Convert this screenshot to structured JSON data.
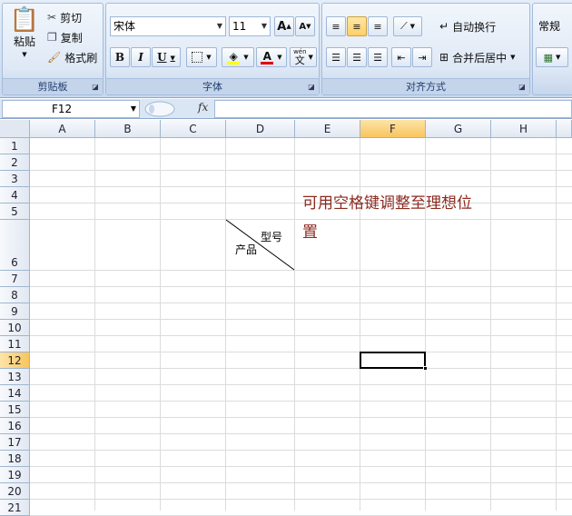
{
  "ribbon": {
    "clipboard": {
      "label": "剪贴板",
      "paste": "粘贴",
      "cut": "剪切",
      "copy": "复制",
      "format_painter": "格式刷"
    },
    "font": {
      "label": "字体",
      "font_name": "宋体",
      "font_size": "11",
      "bold": "B",
      "italic": "I",
      "underline": "U",
      "grow": "A",
      "shrink": "A",
      "font_color_letter": "A",
      "phonetic": "文",
      "phonetic_top": "wén"
    },
    "alignment": {
      "label": "对齐方式",
      "wrap_text": "自动换行",
      "merge_center": "合并后居中"
    },
    "number": {
      "format": "常规"
    }
  },
  "formula_bar": {
    "name_box": "F12",
    "fx": "fx",
    "formula": ""
  },
  "sheet": {
    "columns": [
      "A",
      "B",
      "C",
      "D",
      "E",
      "F",
      "G",
      "H"
    ],
    "rows": [
      "1",
      "2",
      "3",
      "4",
      "5",
      "6",
      "7",
      "8",
      "9",
      "10",
      "11",
      "12",
      "13",
      "14",
      "15",
      "16",
      "17",
      "18",
      "19",
      "20",
      "21"
    ],
    "selected_column": "F",
    "selected_row": "12",
    "cell_D6_top": "型号",
    "cell_D6_bottom": "产品",
    "annotation_line1": "可用空格键调整至理想位",
    "annotation_line2": "置"
  },
  "colors": {
    "annotation": "#8b2a1e",
    "selection_header": "#f8c55f",
    "ribbon_label": "#1e3d6e"
  }
}
